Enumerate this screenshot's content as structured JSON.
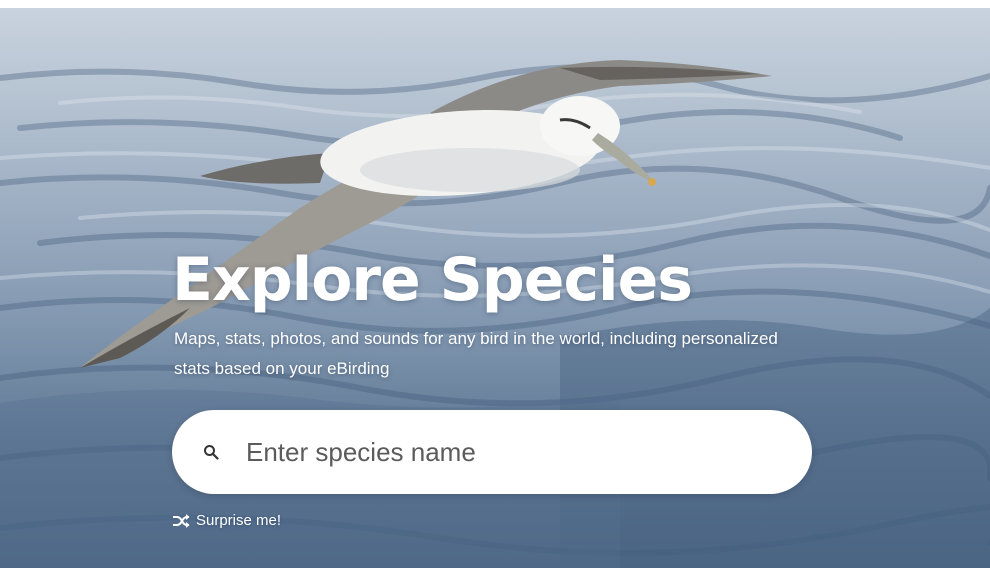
{
  "hero": {
    "title": "Explore Species",
    "subtitle": "Maps, stats, photos, and sounds for any bird in the world, including personalized stats based on your eBirding",
    "background_image": "albatross-over-ocean",
    "search": {
      "placeholder": "Enter species name",
      "value": "",
      "icon": "search-icon"
    },
    "surprise": {
      "label": "Surprise me!",
      "icon": "shuffle-icon"
    }
  },
  "colors": {
    "title_text": "#ffffff",
    "search_bg": "#ffffff",
    "ocean_dark": "#4c6584",
    "ocean_light": "#c9d3de"
  }
}
